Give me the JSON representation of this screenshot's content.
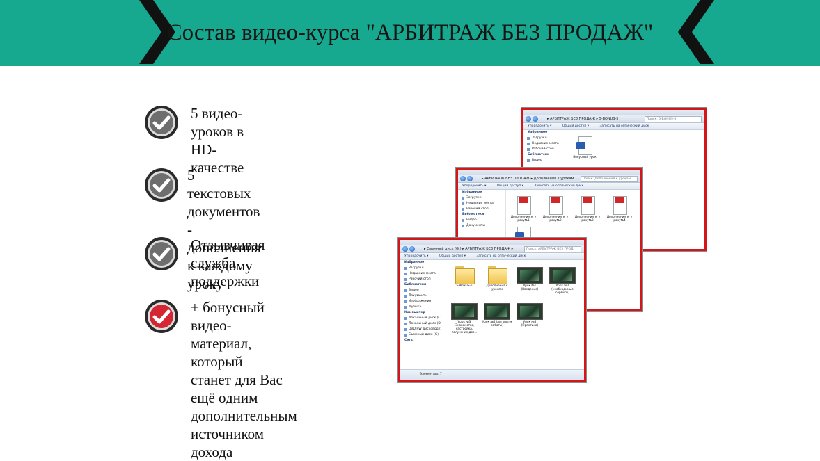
{
  "banner": {
    "title": "Состав видео-курса \"АРБИТРАЖ БЕЗ ПРОДАЖ\"",
    "color": "#17a98f"
  },
  "features": [
    {
      "icon": "check-icon",
      "icon_color": "#6e6e6e",
      "lines": [
        "5 видео-уроков в HD-",
        "качестве"
      ]
    },
    {
      "icon": "check-icon",
      "icon_color": "#6e6e6e",
      "lines": [
        "5 текстовых документов -",
        "дополнения к каждому",
        "уроку"
      ]
    },
    {
      "icon": "check-icon",
      "icon_color": "#6e6e6e",
      "lines": [
        "Отзывчивая служба",
        "поддержки"
      ]
    },
    {
      "icon": "check-icon",
      "icon_color": "#d42633",
      "lines": [
        "+ бонусный видео-",
        "материал, который",
        "станет для Вас ещё одним",
        "дополнительным",
        "источником дохода"
      ]
    }
  ],
  "windows": {
    "common": {
      "toolbar": [
        "Упорядочить ▾",
        "Общий доступ ▾",
        "Записать на оптический диск"
      ],
      "nav": {
        "favorites": "Избранное",
        "downloads": "Загрузки",
        "recent": "Недавние места",
        "desktop": "Рабочий стол",
        "libraries": "Библиотеки",
        "video": "Видео",
        "documents": "Документы",
        "images": "Изображения",
        "music": "Музыка",
        "computer": "Компьютер",
        "disk_c": "Локальный диск (C",
        "disk_d": "Локальный диск (D",
        "dvd": "DVD RW дисковод (",
        "removable": "Съемный диск (G)",
        "network": "Сеть"
      }
    },
    "bonus": {
      "path": "▸ АРБИТРАЖ БЕЗ ПРОДАЖ ▸ 5-BONUS-5",
      "search": "Поиск: 5-BONUS-5",
      "files": [
        {
          "name": "Бонусный урок"
        }
      ]
    },
    "supplements": {
      "path": "▸ АРБИТРАЖ БЕЗ ПРОДАЖ ▸ Дополнения к урокам",
      "search": "Поиск: Дополнения к урокам",
      "files": [
        {
          "name": "Дополнения_к_у року№1"
        },
        {
          "name": "Дополнения_к_у року№2"
        },
        {
          "name": "Дополнения_к_у року№3"
        },
        {
          "name": "Дополнения_к_у року№4"
        },
        {
          "name": ""
        }
      ]
    },
    "main": {
      "path": "▸ Съемный диск (G:) ▸ АРБИТРАЖ БЕЗ ПРОДАЖ ▸",
      "search": "Поиск: АРБИТРАЖ БЕЗ ПРОД",
      "status": "Элементов: 7",
      "files": [
        {
          "name": "5-BONUS-5"
        },
        {
          "name": "Дополнения к урокам"
        },
        {
          "name": "Урок №1 (Введение)"
        },
        {
          "name": "Урок №2 (необходимые сервисы)"
        },
        {
          "name": "Урок №3 (Знакомство, настройка, получение дос..."
        },
        {
          "name": "Урок №4 (алгоритм работы)"
        },
        {
          "name": "Урок №5 (Практика)"
        }
      ]
    }
  }
}
